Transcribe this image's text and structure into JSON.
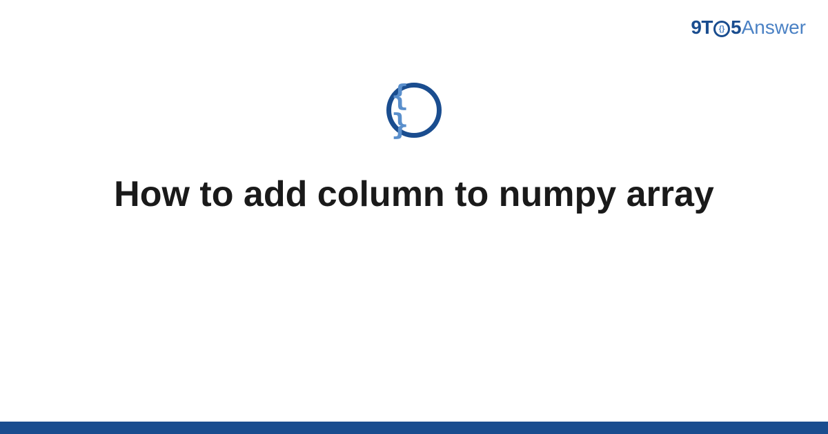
{
  "logo": {
    "part1": "9T",
    "inner_braces": "{}",
    "part2": "5",
    "part3": "Answer"
  },
  "category_icon": {
    "symbol": "{ }",
    "name": "code-braces-icon"
  },
  "title": "How to add column to numpy array",
  "colors": {
    "brand_dark": "#1a4d8f",
    "brand_light": "#4a81c4",
    "text": "#1a1a1a"
  }
}
